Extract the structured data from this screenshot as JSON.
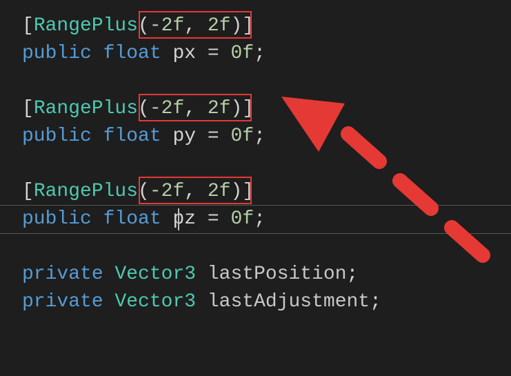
{
  "code": {
    "attr1": {
      "open": "[",
      "name": "RangePlus",
      "paren_open": "(",
      "arg1": "-2f",
      "comma": ", ",
      "arg2": "2f",
      "paren_close": ")",
      "close": "]"
    },
    "decl1": {
      "mod": "public",
      "sp1": " ",
      "type": "float",
      "sp2": " ",
      "name": "px",
      "sp3": " ",
      "eq": "=",
      "sp4": " ",
      "val": "0f",
      "semi": ";"
    },
    "attr2": {
      "open": "[",
      "name": "RangePlus",
      "paren_open": "(",
      "arg1": "-2f",
      "comma": ", ",
      "arg2": "2f",
      "paren_close": ")",
      "close": "]"
    },
    "decl2": {
      "mod": "public",
      "sp1": " ",
      "type": "float",
      "sp2": " ",
      "name": "py",
      "sp3": " ",
      "eq": "=",
      "sp4": " ",
      "val": "0f",
      "semi": ";"
    },
    "attr3": {
      "open": "[",
      "name": "RangePlus",
      "paren_open": "(",
      "arg1": "-2f",
      "comma": ", ",
      "arg2": "2f",
      "paren_close": ")",
      "close": "]"
    },
    "decl3": {
      "mod": "public",
      "sp1": " ",
      "type": "float",
      "sp2": " ",
      "name": "pz",
      "sp3": " ",
      "eq": "=",
      "sp4": " ",
      "val": "0f",
      "semi": ";"
    },
    "priv1": {
      "mod": "private",
      "sp1": " ",
      "type": "Vector3",
      "sp2": " ",
      "name": "lastPosition",
      "semi": ";"
    },
    "priv2": {
      "mod": "private",
      "sp1": " ",
      "type": "Vector3",
      "sp2": " ",
      "name": "lastAdjustment",
      "semi": ";"
    }
  },
  "annotation": {
    "arrow": "highlight-arrow"
  }
}
